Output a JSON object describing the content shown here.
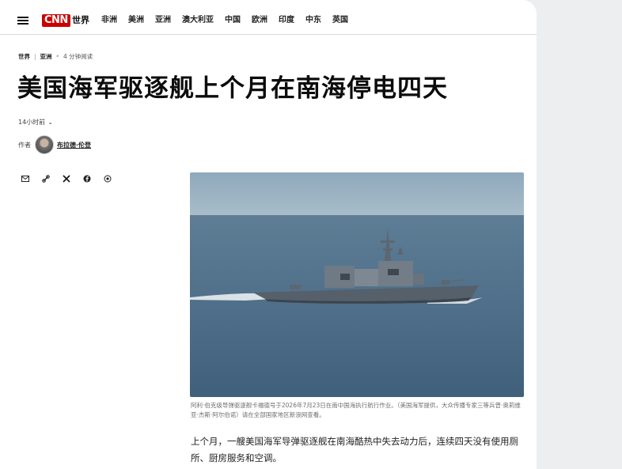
{
  "nav": {
    "logo": "CNN",
    "edition": "世界",
    "items": [
      "非洲",
      "美洲",
      "亚洲",
      "澳大利亚",
      "中国",
      "欧洲",
      "印度",
      "中东",
      "英国"
    ]
  },
  "breadcrumb": {
    "section": "世界",
    "subsection": "亚洲",
    "extra": "4 分钟阅读"
  },
  "article": {
    "headline": "美国海军驱逐舰上个月在南海停电四天",
    "timestamp": "14小时前",
    "byline_prefix": "作者",
    "author": "布拉德·伦登",
    "caption": "阿利·伯克级导弹驱逐舰卡福德号于2026年7月23日在南中国海执行航行作业。（美国海军提供，大众传播专家三等兵曾·奥莉维亚·杰斯·阿尔伯诺）请在全部国家地区新浪网查看。",
    "body": "上个月，一艘美国海军导弹驱逐舰在南海酷热中失去动力后，连续四天没有使用厕所、厨房服务和空调。"
  },
  "icons": {
    "menu": "hamburger-icon",
    "share": [
      "email-icon",
      "link-icon",
      "x-icon",
      "facebook-icon",
      "copy-icon"
    ]
  },
  "colors": {
    "brand": "#cc0000",
    "headline": "#0c0c0c"
  }
}
